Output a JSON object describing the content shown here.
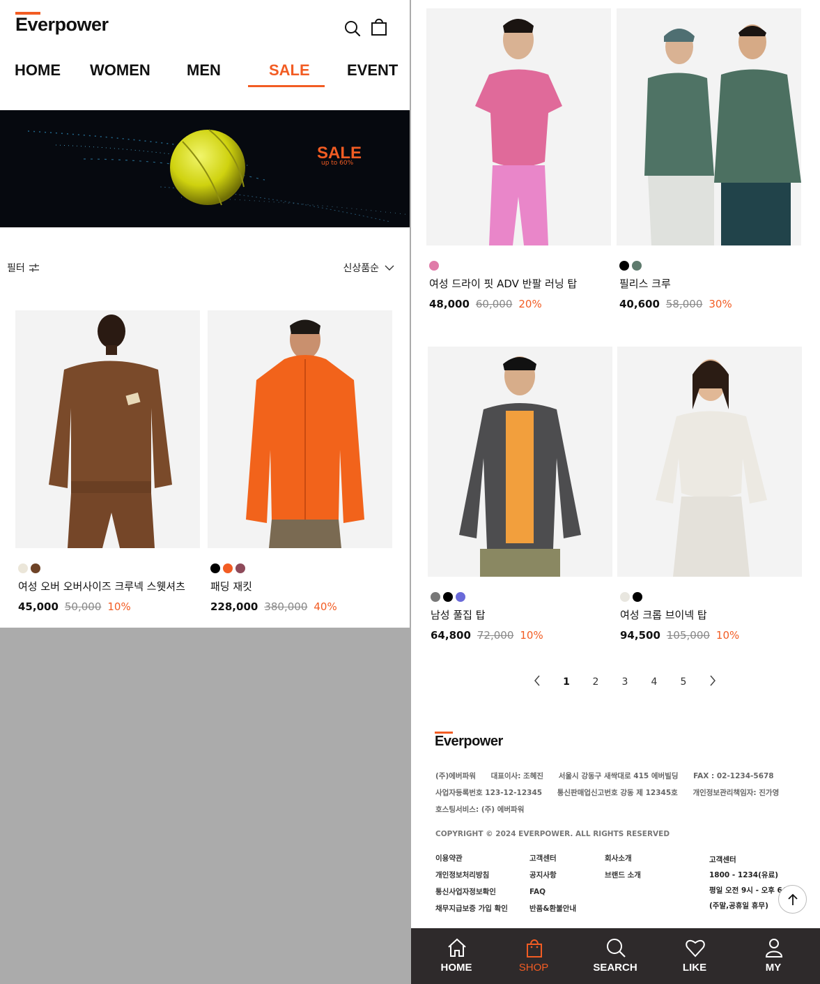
{
  "brand": {
    "name": "Everpower",
    "accent": "#f25c23"
  },
  "nav": [
    "HOME",
    "WOMEN",
    "MEN",
    "SALE",
    "EVENT"
  ],
  "banner": {
    "title": "SALE",
    "subtitle": "up to 60%"
  },
  "filter": {
    "label": "필터",
    "sort": "신상품순"
  },
  "products": [
    {
      "name": "여성 오버 오버사이즈 크루넥 스웻셔츠",
      "price": "45,000",
      "original": "50,000",
      "discount": "10%",
      "colors": [
        "#ebe6d9",
        "#6e4327"
      ]
    },
    {
      "name": "패딩 재킷",
      "price": "228,000",
      "original": "380,000",
      "discount": "40%",
      "colors": [
        "#000000",
        "#f25c23",
        "#8e4a5a"
      ]
    },
    {
      "name": "여성 드라이 핏 ADV 반팔 러닝 탑",
      "price": "48,000",
      "original": "60,000",
      "discount": "20%",
      "colors": [
        "#e07ba8"
      ]
    },
    {
      "name": "필리스 크루",
      "price": "40,600",
      "original": "58,000",
      "discount": "30%",
      "colors": [
        "#000000",
        "#5e7a6d"
      ]
    },
    {
      "name": "남성 풀집 탑",
      "price": "64,800",
      "original": "72,000",
      "discount": "10%",
      "colors": [
        "#777777",
        "#000000",
        "#6a6ad9"
      ]
    },
    {
      "name": "여성 크롭 브이넥 탑",
      "price": "94,500",
      "original": "105,000",
      "discount": "10%",
      "colors": [
        "#e8e6df",
        "#000000"
      ]
    }
  ],
  "pagination": {
    "pages": [
      "1",
      "2",
      "3",
      "4",
      "5"
    ],
    "current": "1"
  },
  "footer": {
    "logo": "Everpower",
    "info_line1": [
      "(주)에버파워",
      "대표이사: 조혜진",
      "서울시 강동구 새싹대로 415 에버빌딩",
      "FAX : 02-1234-5678"
    ],
    "info_line2": [
      "사업자등록번호 123-12-12345",
      "통신판매업신고번호 강동 제 12345호",
      "개인정보관리책임자: 진가영"
    ],
    "info_line3": [
      "호스팅서비스: (주) 에버파워"
    ],
    "copyright": "COPYRIGHT © 2024 EVERPOWER. ALL RIGHTS RESERVED",
    "col1": [
      "이용약관",
      "개인정보처리방침",
      "통신사업자정보확인",
      "채무지급보증 가입 확인"
    ],
    "col2": [
      "고객센터",
      "공지사항",
      "FAQ",
      "반품&환불안내"
    ],
    "col3": [
      "회사소개",
      "브랜드 소개"
    ],
    "cs_title": "고객센터",
    "cs_phone": "1800 - 1234(유료)",
    "cs_hours": "평일 오전 9시 - 오후 6시",
    "cs_closed": "(주말,공휴일 휴무)"
  },
  "tabbar": [
    {
      "label": "HOME",
      "icon": "home-icon"
    },
    {
      "label": "SHOP",
      "icon": "shopping-bag-icon"
    },
    {
      "label": "SEARCH",
      "icon": "search-icon"
    },
    {
      "label": "LIKE",
      "icon": "heart-icon"
    },
    {
      "label": "MY",
      "icon": "user-icon"
    }
  ]
}
